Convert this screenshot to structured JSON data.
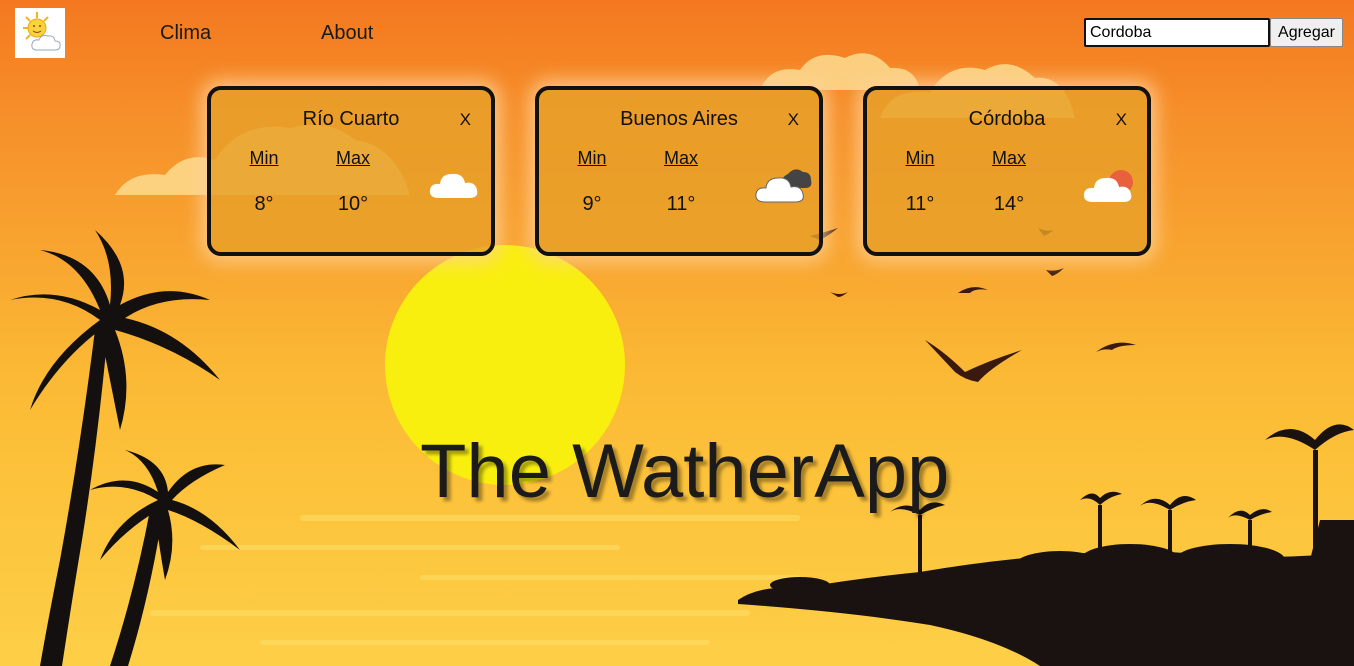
{
  "nav": {
    "logo_icon": "sun-cloud-icon",
    "links": [
      "Clima",
      "About"
    ]
  },
  "search": {
    "value": "Cordoba",
    "button_label": "Agregar"
  },
  "cards": [
    {
      "city": "Río Cuarto",
      "close": "X",
      "min_label": "Min",
      "max_label": "Max",
      "min": "8°",
      "max": "10°",
      "icon": "cloud-icon"
    },
    {
      "city": "Buenos Aires",
      "close": "X",
      "min_label": "Min",
      "max_label": "Max",
      "min": "9°",
      "max": "11°",
      "icon": "dark-clouds-icon"
    },
    {
      "city": "Córdoba",
      "close": "X",
      "min_label": "Min",
      "max_label": "Max",
      "min": "11°",
      "max": "14°",
      "icon": "sun-cloud-icon"
    }
  ],
  "title": "The WatherApp",
  "colors": {
    "sky_top": "#f47820",
    "sky_bottom": "#fdcf47",
    "sun": "#f9ef0f",
    "silhouette": "#1a1210",
    "card_border": "#111111"
  }
}
